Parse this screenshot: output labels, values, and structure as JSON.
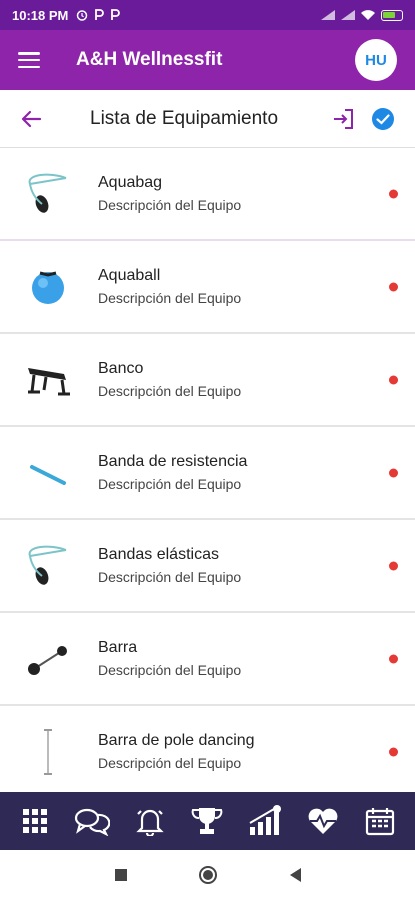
{
  "status": {
    "time": "10:18 PM",
    "icons": [
      "alarm-icon",
      "p-icon",
      "p-icon"
    ],
    "right_icons": [
      "signal-icon",
      "signal-icon",
      "wifi-icon",
      "battery-icon"
    ]
  },
  "appbar": {
    "title": "A&H Wellnessfit",
    "avatar": "HU"
  },
  "subheader": {
    "title": "Lista de Equipamiento"
  },
  "items": [
    {
      "name": "Aquabag",
      "desc": "Descripción del Equipo",
      "icon": "aquabag-icon"
    },
    {
      "name": "Aquaball",
      "desc": "Descripción del Equipo",
      "icon": "aquaball-icon"
    },
    {
      "name": "Banco",
      "desc": "Descripción del Equipo",
      "icon": "bench-icon"
    },
    {
      "name": "Banda de resistencia",
      "desc": "Descripción del Equipo",
      "icon": "resistance-band-icon"
    },
    {
      "name": "Bandas elásticas",
      "desc": "Descripción del Equipo",
      "icon": "elastic-bands-icon"
    },
    {
      "name": "Barra",
      "desc": "Descripción del Equipo",
      "icon": "barbell-icon"
    },
    {
      "name": "Barra de pole dancing",
      "desc": "Descripción del Equipo",
      "icon": "pole-icon"
    }
  ],
  "bottom_nav": [
    "grid-icon",
    "chat-icon",
    "bell-icon",
    "trophy-icon",
    "stats-icon",
    "heart-icon",
    "calendar-icon"
  ],
  "colors": {
    "statusbar": "#6a1b9a",
    "appbar": "#8e24aa",
    "accent": "#8e24aa",
    "check": "#1e88e5",
    "dot": "#e53935",
    "bottombar": "#2e2a55"
  }
}
